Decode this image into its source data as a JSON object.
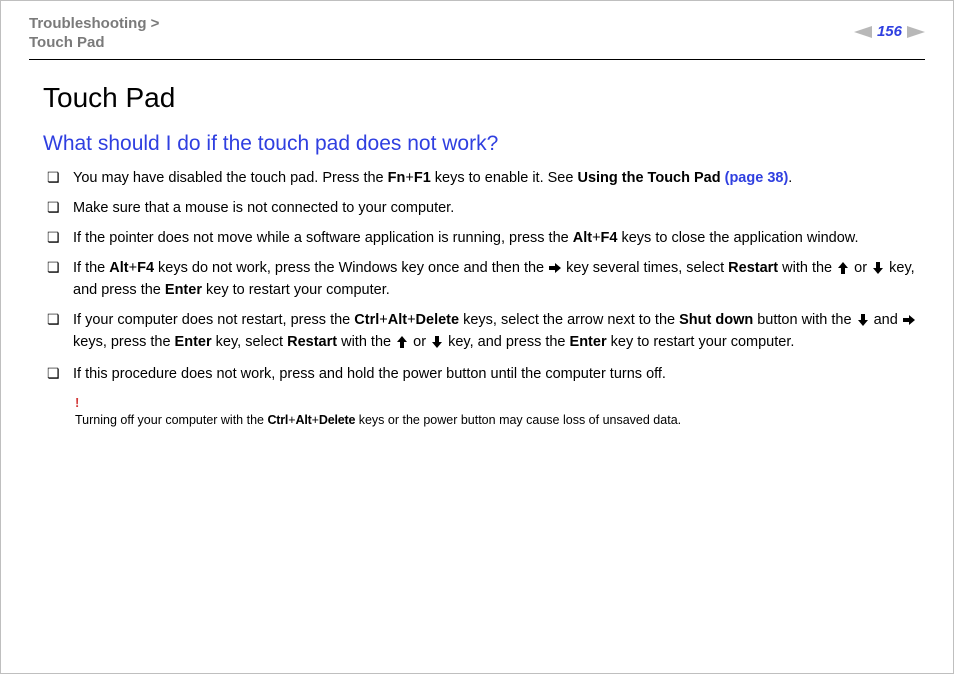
{
  "header": {
    "breadcrumb_section": "Troubleshooting",
    "breadcrumb_sep": " >",
    "breadcrumb_page": "Touch Pad",
    "page_number": "156"
  },
  "content": {
    "title": "Touch Pad",
    "question": "What should I do if the touch pad does not work?",
    "bullets": {
      "b0": {
        "t0": "You may have disabled the touch pad. Press the ",
        "k0": "Fn",
        "plus0": "+",
        "k1": "F1",
        "t1": " keys to enable it. See ",
        "link_label": "Using the Touch Pad ",
        "link_page": "(page 38)",
        "t2": "."
      },
      "b1": "Make sure that a mouse is not connected to your computer.",
      "b2": {
        "t0": "If the pointer does not move while a software application is running, press the ",
        "k0": "Alt",
        "plus0": "+",
        "k1": "F4",
        "t1": " keys to close the application window."
      },
      "b3": {
        "t0": "If the ",
        "k0": "Alt",
        "plus0": "+",
        "k1": "F4",
        "t1": " keys do not work, press the Windows key once and then the ",
        "t2": " key several times, select ",
        "k2": "Restart",
        "t3": " with the ",
        "t4": " or ",
        "t5": " key, and press the ",
        "k3": "Enter",
        "t6": " key to restart your computer."
      },
      "b4": {
        "t0": "If your computer does not restart, press the ",
        "k0": "Ctrl",
        "plus0": "+",
        "k1": "Alt",
        "plus1": "+",
        "k2": "Delete",
        "t1": " keys, select the arrow next to the ",
        "k3": "Shut down",
        "t2": " button with the ",
        "t3": " and ",
        "t4": " keys, press the ",
        "k4": "Enter",
        "t5": " key, select ",
        "k5": "Restart",
        "t6": " with the ",
        "t7": " or ",
        "t8": " key, and press the ",
        "k6": "Enter",
        "t9": " key to restart your computer."
      },
      "b5": "If this procedure does not work, press and hold the power button until the computer turns off."
    },
    "note": {
      "bang": "!",
      "t0": "Turning off your computer with the ",
      "k0": "Ctrl",
      "plus0": "+",
      "k1": "Alt",
      "plus1": "+",
      "k2": "Delete",
      "t1": " keys or the power button may cause loss of unsaved data."
    }
  }
}
